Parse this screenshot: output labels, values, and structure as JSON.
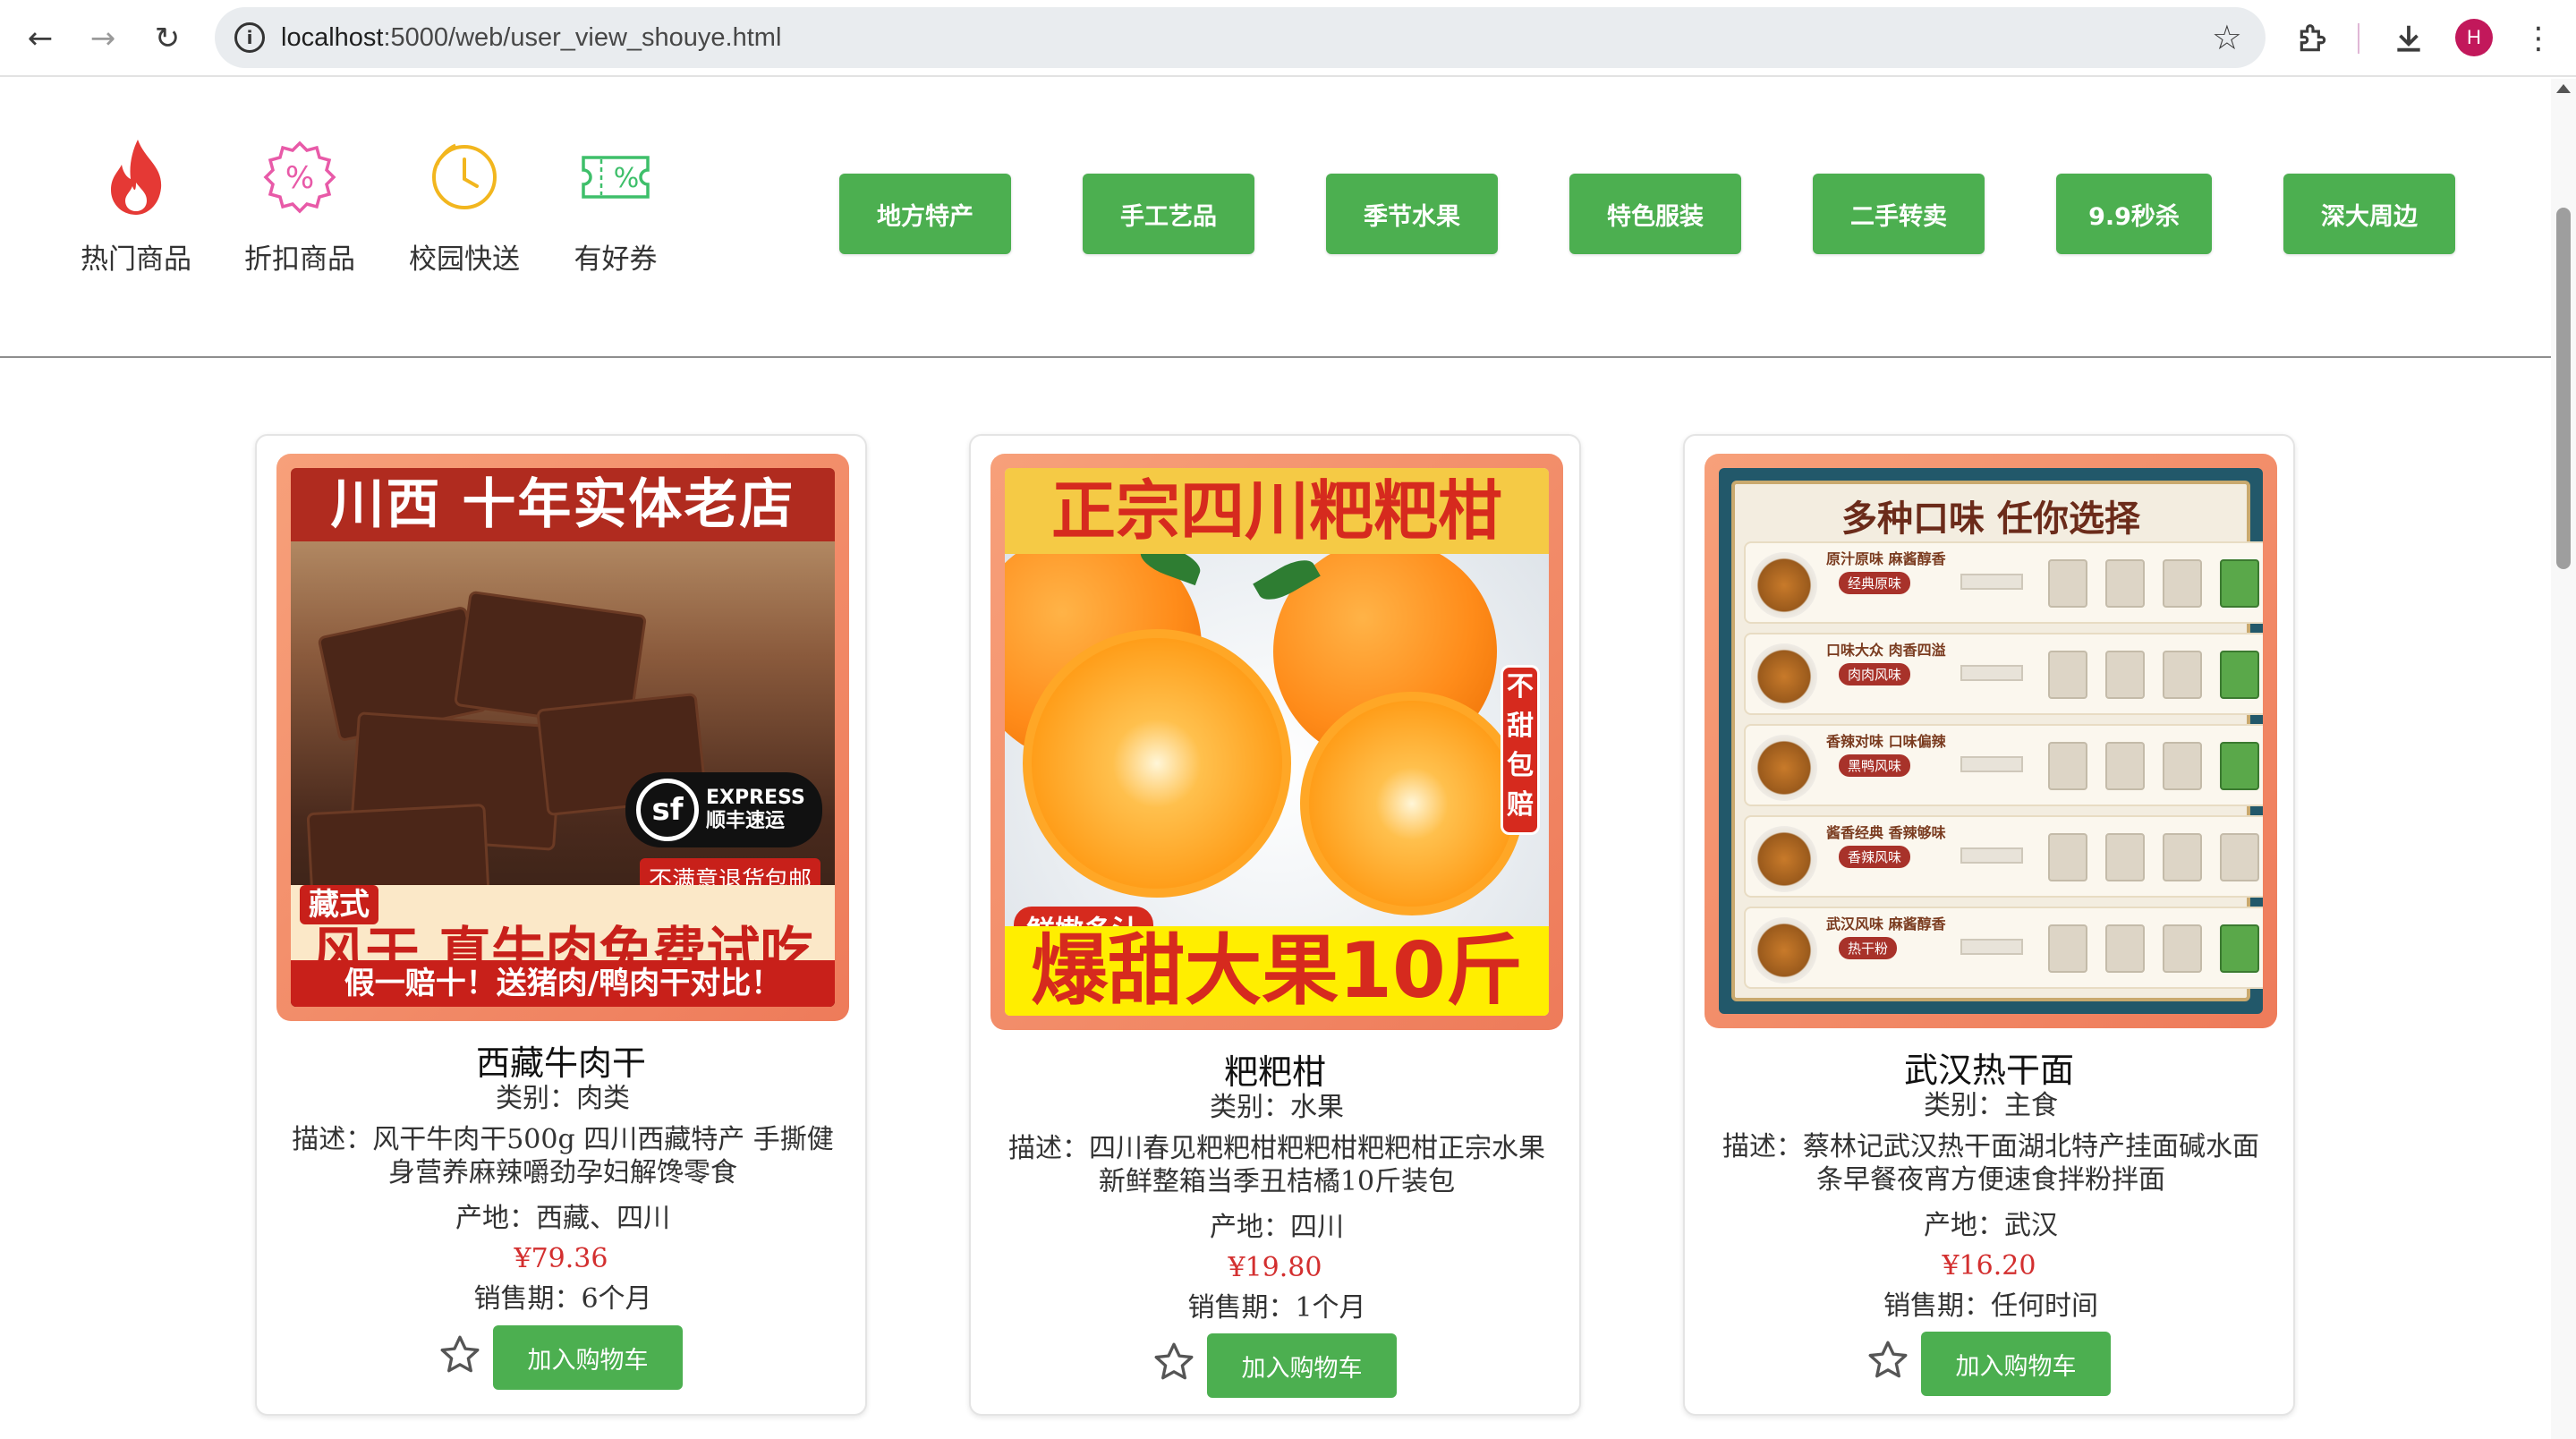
{
  "browser": {
    "url_host": "localhost",
    "url_path": ":5000/web/user_view_shouye.html",
    "profile_initial": "H"
  },
  "quick_links": [
    {
      "label": "热门商品",
      "icon": "fire-icon",
      "color": "#e53935"
    },
    {
      "label": "折扣商品",
      "icon": "discount-badge-icon",
      "color": "#e85aa8"
    },
    {
      "label": "校园快送",
      "icon": "clock-icon",
      "color": "#f2b61e"
    },
    {
      "label": "有好券",
      "icon": "coupon-icon",
      "color": "#3ebf6a"
    }
  ],
  "categories": [
    "地方特产",
    "手工艺品",
    "季节水果",
    "特色服装",
    "二手转卖",
    "9.9秒杀",
    "深大周边"
  ],
  "theme": {
    "accent_green": "#4caf50",
    "price_red": "#d32f2f"
  },
  "products": [
    {
      "name": "西藏牛肉干",
      "category": "类别：肉类",
      "description": "描述：风干牛肉干500g 四川西藏特产 手撕健身营养麻辣嚼劲孕妇解馋零食",
      "origin": "产地：西藏、四川",
      "price": "¥79.36",
      "sale_period": "销售期：6个月",
      "cart_label": "加入购物车",
      "image_text": {
        "top": "川西 十年实体老店",
        "sf_line1": "EXPRESS",
        "sf_line2": "顺丰速运",
        "tag": "不满意退货包邮",
        "badge": "藏式",
        "headline": "风干 真牛肉免费试吃",
        "bottom": "假一赔十！送猪肉/鸭肉干对比！"
      }
    },
    {
      "name": "粑粑柑",
      "category": "类别：水果",
      "description": "描述：四川春见粑粑柑粑粑柑粑粑柑正宗水果新鲜整箱当季丑桔橘10斤装包",
      "origin": "产地：四川",
      "price": "¥19.80",
      "sale_period": "销售期：1个月",
      "cart_label": "加入购物车",
      "image_text": {
        "top": "正宗四川粑粑柑",
        "side": "不甜包赔",
        "tag": "鲜嫩多汁",
        "bottom": "爆甜大果10斤"
      }
    },
    {
      "name": "武汉热干面",
      "category": "类别：主食",
      "description": "描述：蔡林记武汉热干面湖北特产挂面碱水面条早餐夜宵方便速食拌粉拌面",
      "origin": "产地：武汉",
      "price": "¥16.20",
      "sale_period": "销售期：任何时间",
      "cart_label": "加入购物车",
      "image_text": {
        "title": "多种口味 任你选择",
        "rows": [
          {
            "desc": "原汁原味 麻酱醇香",
            "pill": "经典原味"
          },
          {
            "desc": "口味大众 肉香四溢",
            "pill": "肉肉风味"
          },
          {
            "desc": "香辣对味 口味偏辣",
            "pill": "黑鸭风味"
          },
          {
            "desc": "酱香经典 香辣够味",
            "pill": "香辣风味"
          },
          {
            "desc": "武汉风味 麻酱醇香",
            "pill": "热干粉"
          }
        ]
      }
    }
  ]
}
